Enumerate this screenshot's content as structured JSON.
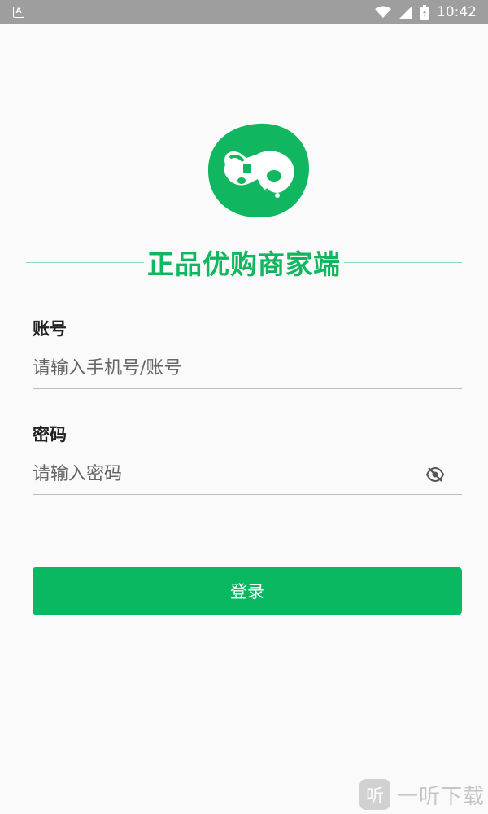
{
  "status_bar": {
    "notification_icon": "A",
    "time": "10:42",
    "icons": [
      "wifi-icon",
      "signal-icon",
      "battery-icon"
    ]
  },
  "app": {
    "title": "正品优购商家端",
    "brand_color": "#0bb862"
  },
  "form": {
    "account": {
      "label": "账号",
      "placeholder": "请输入手机号/账号",
      "value": ""
    },
    "password": {
      "label": "密码",
      "placeholder": "请输入密码",
      "value": ""
    },
    "login_label": "登录"
  },
  "watermark": {
    "badge": "听",
    "text": "一听下载"
  }
}
